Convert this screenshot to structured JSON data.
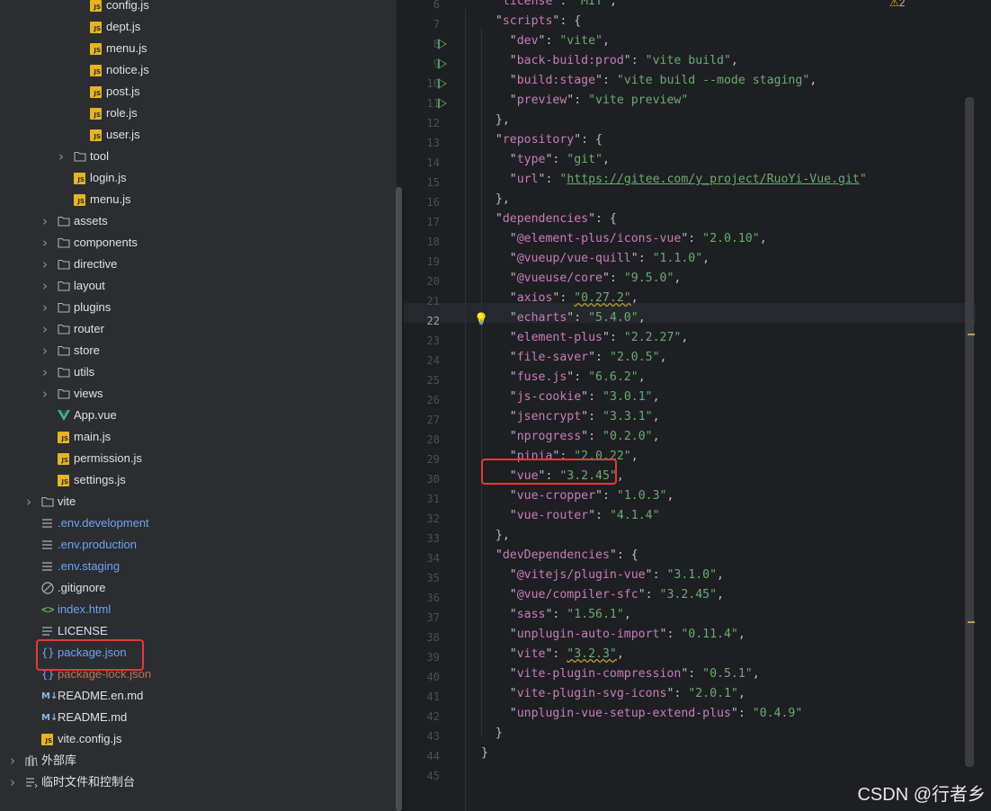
{
  "project_tree": {
    "items": [
      {
        "label": "config.js",
        "type": "js",
        "indent": 4
      },
      {
        "label": "dept.js",
        "type": "js",
        "indent": 4
      },
      {
        "label": "menu.js",
        "type": "js",
        "indent": 4
      },
      {
        "label": "notice.js",
        "type": "js",
        "indent": 4
      },
      {
        "label": "post.js",
        "type": "js",
        "indent": 4
      },
      {
        "label": "role.js",
        "type": "js",
        "indent": 4
      },
      {
        "label": "user.js",
        "type": "js",
        "indent": 4
      },
      {
        "label": "tool",
        "type": "folder",
        "indent": 3
      },
      {
        "label": "login.js",
        "type": "js",
        "indent": 3
      },
      {
        "label": "menu.js",
        "type": "js",
        "indent": 3
      },
      {
        "label": "assets",
        "type": "folder",
        "indent": 2
      },
      {
        "label": "components",
        "type": "folder",
        "indent": 2
      },
      {
        "label": "directive",
        "type": "folder",
        "indent": 2
      },
      {
        "label": "layout",
        "type": "folder",
        "indent": 2
      },
      {
        "label": "plugins",
        "type": "folder",
        "indent": 2
      },
      {
        "label": "router",
        "type": "folder",
        "indent": 2
      },
      {
        "label": "store",
        "type": "folder",
        "indent": 2
      },
      {
        "label": "utils",
        "type": "folder",
        "indent": 2
      },
      {
        "label": "views",
        "type": "folder",
        "indent": 2
      },
      {
        "label": "App.vue",
        "type": "vue",
        "indent": 2
      },
      {
        "label": "main.js",
        "type": "js",
        "indent": 2
      },
      {
        "label": "permission.js",
        "type": "js",
        "indent": 2
      },
      {
        "label": "settings.js",
        "type": "js",
        "indent": 2
      },
      {
        "label": "vite",
        "type": "folder",
        "indent": 1
      },
      {
        "label": ".env.development",
        "type": "env",
        "indent": 1
      },
      {
        "label": ".env.production",
        "type": "env",
        "indent": 1
      },
      {
        "label": ".env.staging",
        "type": "env",
        "indent": 1
      },
      {
        "label": ".gitignore",
        "type": "ignore",
        "indent": 1
      },
      {
        "label": "index.html",
        "type": "html",
        "indent": 1
      },
      {
        "label": "LICENSE",
        "type": "text",
        "indent": 1
      },
      {
        "label": "package.json",
        "type": "json",
        "indent": 1
      },
      {
        "label": "package-lock.json",
        "type": "json-orange",
        "indent": 1
      },
      {
        "label": "README.en.md",
        "type": "md",
        "indent": 1
      },
      {
        "label": "README.md",
        "type": "md",
        "indent": 1
      },
      {
        "label": "vite.config.js",
        "type": "js",
        "indent": 1
      },
      {
        "label": "外部库",
        "type": "lib",
        "indent": 0
      },
      {
        "label": "临时文件和控制台",
        "type": "scratch",
        "indent": 0
      }
    ]
  },
  "editor": {
    "warning_count": "2",
    "lines": [
      {
        "n": "6",
        "tokens": [
          [
            "p",
            "  \""
          ],
          [
            "k",
            "license"
          ],
          [
            "p",
            "\": "
          ],
          [
            "s",
            "\"MIT\""
          ],
          [
            "p",
            ","
          ]
        ]
      },
      {
        "n": "7",
        "tokens": [
          [
            "p",
            "  \""
          ],
          [
            "k",
            "scripts"
          ],
          [
            "p",
            "\": {"
          ]
        ]
      },
      {
        "n": "8",
        "tokens": [
          [
            "p",
            "    \""
          ],
          [
            "k",
            "dev"
          ],
          [
            "p",
            "\": "
          ],
          [
            "s",
            "\"vite\""
          ],
          [
            "p",
            ","
          ]
        ]
      },
      {
        "n": "9",
        "tokens": [
          [
            "p",
            "    \""
          ],
          [
            "k",
            "back-build:prod"
          ],
          [
            "p",
            "\": "
          ],
          [
            "s",
            "\"vite build\""
          ],
          [
            "p",
            ","
          ]
        ]
      },
      {
        "n": "10",
        "tokens": [
          [
            "p",
            "    \""
          ],
          [
            "k",
            "build:stage"
          ],
          [
            "p",
            "\": "
          ],
          [
            "s",
            "\"vite build --mode staging\""
          ],
          [
            "p",
            ","
          ]
        ]
      },
      {
        "n": "11",
        "tokens": [
          [
            "p",
            "    \""
          ],
          [
            "k",
            "preview"
          ],
          [
            "p",
            "\": "
          ],
          [
            "s",
            "\"vite preview\""
          ]
        ]
      },
      {
        "n": "12",
        "tokens": [
          [
            "p",
            "  },"
          ]
        ]
      },
      {
        "n": "13",
        "tokens": [
          [
            "p",
            "  \""
          ],
          [
            "k",
            "repository"
          ],
          [
            "p",
            "\": {"
          ]
        ]
      },
      {
        "n": "14",
        "tokens": [
          [
            "p",
            "    \""
          ],
          [
            "k",
            "type"
          ],
          [
            "p",
            "\": "
          ],
          [
            "s",
            "\"git\""
          ],
          [
            "p",
            ","
          ]
        ]
      },
      {
        "n": "15",
        "tokens": [
          [
            "p",
            "    \""
          ],
          [
            "k",
            "url"
          ],
          [
            "p",
            "\": "
          ],
          [
            "s",
            "\""
          ],
          [
            "u",
            "https://gitee.com/y_project/RuoYi-Vue.git"
          ],
          [
            "s",
            "\""
          ]
        ]
      },
      {
        "n": "16",
        "tokens": [
          [
            "p",
            "  },"
          ]
        ]
      },
      {
        "n": "17",
        "tokens": [
          [
            "p",
            "  \""
          ],
          [
            "k",
            "dependencies"
          ],
          [
            "p",
            "\": {"
          ]
        ]
      },
      {
        "n": "18",
        "tokens": [
          [
            "p",
            "    \""
          ],
          [
            "k",
            "@element-plus/icons-vue"
          ],
          [
            "p",
            "\": "
          ],
          [
            "s",
            "\"2.0.10\""
          ],
          [
            "p",
            ","
          ]
        ]
      },
      {
        "n": "19",
        "tokens": [
          [
            "p",
            "    \""
          ],
          [
            "k",
            "@vueup/vue-quill"
          ],
          [
            "p",
            "\": "
          ],
          [
            "s",
            "\"1.1.0\""
          ],
          [
            "p",
            ","
          ]
        ]
      },
      {
        "n": "20",
        "tokens": [
          [
            "p",
            "    \""
          ],
          [
            "k",
            "@vueuse/core"
          ],
          [
            "p",
            "\": "
          ],
          [
            "s",
            "\"9.5.0\""
          ],
          [
            "p",
            ","
          ]
        ]
      },
      {
        "n": "21",
        "tokens": [
          [
            "p",
            "    \""
          ],
          [
            "k",
            "axios"
          ],
          [
            "p",
            "\": "
          ],
          [
            "w",
            "\"0.27.2\""
          ],
          [
            "p",
            ","
          ]
        ]
      },
      {
        "n": "22",
        "tokens": [
          [
            "p",
            "    \""
          ],
          [
            "k",
            "echarts"
          ],
          [
            "p",
            "\": "
          ],
          [
            "s",
            "\"5.4.0\""
          ],
          [
            "p",
            ","
          ]
        ]
      },
      {
        "n": "23",
        "tokens": [
          [
            "p",
            "    \""
          ],
          [
            "k",
            "element-plus"
          ],
          [
            "p",
            "\": "
          ],
          [
            "s",
            "\"2.2.27\""
          ],
          [
            "p",
            ","
          ]
        ]
      },
      {
        "n": "24",
        "tokens": [
          [
            "p",
            "    \""
          ],
          [
            "k",
            "file-saver"
          ],
          [
            "p",
            "\": "
          ],
          [
            "s",
            "\"2.0.5\""
          ],
          [
            "p",
            ","
          ]
        ]
      },
      {
        "n": "25",
        "tokens": [
          [
            "p",
            "    \""
          ],
          [
            "k",
            "fuse.js"
          ],
          [
            "p",
            "\": "
          ],
          [
            "s",
            "\"6.6.2\""
          ],
          [
            "p",
            ","
          ]
        ]
      },
      {
        "n": "26",
        "tokens": [
          [
            "p",
            "    \""
          ],
          [
            "k",
            "js-cookie"
          ],
          [
            "p",
            "\": "
          ],
          [
            "s",
            "\"3.0.1\""
          ],
          [
            "p",
            ","
          ]
        ]
      },
      {
        "n": "27",
        "tokens": [
          [
            "p",
            "    \""
          ],
          [
            "k",
            "jsencrypt"
          ],
          [
            "p",
            "\": "
          ],
          [
            "s",
            "\"3.3.1\""
          ],
          [
            "p",
            ","
          ]
        ]
      },
      {
        "n": "28",
        "tokens": [
          [
            "p",
            "    \""
          ],
          [
            "k",
            "nprogress"
          ],
          [
            "p",
            "\": "
          ],
          [
            "s",
            "\"0.2.0\""
          ],
          [
            "p",
            ","
          ]
        ]
      },
      {
        "n": "29",
        "tokens": [
          [
            "p",
            "    \""
          ],
          [
            "k",
            "pinia"
          ],
          [
            "p",
            "\": "
          ],
          [
            "s",
            "\"2.0.22\""
          ],
          [
            "p",
            ","
          ]
        ]
      },
      {
        "n": "30",
        "tokens": [
          [
            "p",
            "    \""
          ],
          [
            "k",
            "vue"
          ],
          [
            "p",
            "\": "
          ],
          [
            "s",
            "\"3.2.45\""
          ],
          [
            "p",
            ","
          ]
        ]
      },
      {
        "n": "31",
        "tokens": [
          [
            "p",
            "    \""
          ],
          [
            "k",
            "vue-cropper"
          ],
          [
            "p",
            "\": "
          ],
          [
            "s",
            "\"1.0.3\""
          ],
          [
            "p",
            ","
          ]
        ]
      },
      {
        "n": "32",
        "tokens": [
          [
            "p",
            "    \""
          ],
          [
            "k",
            "vue-router"
          ],
          [
            "p",
            "\": "
          ],
          [
            "s",
            "\"4.1.4\""
          ]
        ]
      },
      {
        "n": "33",
        "tokens": [
          [
            "p",
            "  },"
          ]
        ]
      },
      {
        "n": "34",
        "tokens": [
          [
            "p",
            "  \""
          ],
          [
            "k",
            "devDependencies"
          ],
          [
            "p",
            "\": {"
          ]
        ]
      },
      {
        "n": "35",
        "tokens": [
          [
            "p",
            "    \""
          ],
          [
            "k",
            "@vitejs/plugin-vue"
          ],
          [
            "p",
            "\": "
          ],
          [
            "s",
            "\"3.1.0\""
          ],
          [
            "p",
            ","
          ]
        ]
      },
      {
        "n": "36",
        "tokens": [
          [
            "p",
            "    \""
          ],
          [
            "k",
            "@vue/compiler-sfc"
          ],
          [
            "p",
            "\": "
          ],
          [
            "s",
            "\"3.2.45\""
          ],
          [
            "p",
            ","
          ]
        ]
      },
      {
        "n": "37",
        "tokens": [
          [
            "p",
            "    \""
          ],
          [
            "k",
            "sass"
          ],
          [
            "p",
            "\": "
          ],
          [
            "s",
            "\"1.56.1\""
          ],
          [
            "p",
            ","
          ]
        ]
      },
      {
        "n": "38",
        "tokens": [
          [
            "p",
            "    \""
          ],
          [
            "k",
            "unplugin-auto-import"
          ],
          [
            "p",
            "\": "
          ],
          [
            "s",
            "\"0.11.4\""
          ],
          [
            "p",
            ","
          ]
        ]
      },
      {
        "n": "39",
        "tokens": [
          [
            "p",
            "    \""
          ],
          [
            "k",
            "vite"
          ],
          [
            "p",
            "\": "
          ],
          [
            "w",
            "\"3.2.3\""
          ],
          [
            "p",
            ","
          ]
        ]
      },
      {
        "n": "40",
        "tokens": [
          [
            "p",
            "    \""
          ],
          [
            "k",
            "vite-plugin-compression"
          ],
          [
            "p",
            "\": "
          ],
          [
            "s",
            "\"0.5.1\""
          ],
          [
            "p",
            ","
          ]
        ]
      },
      {
        "n": "41",
        "tokens": [
          [
            "p",
            "    \""
          ],
          [
            "k",
            "vite-plugin-svg-icons"
          ],
          [
            "p",
            "\": "
          ],
          [
            "s",
            "\"2.0.1\""
          ],
          [
            "p",
            ","
          ]
        ]
      },
      {
        "n": "42",
        "tokens": [
          [
            "p",
            "    \""
          ],
          [
            "k",
            "unplugin-vue-setup-extend-plus"
          ],
          [
            "p",
            "\": "
          ],
          [
            "s",
            "\"0.4.9\""
          ]
        ]
      },
      {
        "n": "43",
        "tokens": [
          [
            "p",
            "  }"
          ]
        ]
      },
      {
        "n": "44",
        "tokens": [
          [
            "p",
            "}"
          ]
        ]
      },
      {
        "n": "45",
        "tokens": []
      }
    ]
  },
  "watermark": "CSDN @行者乡",
  "colors": {
    "accent_red": "#e03a3a",
    "key_purple": "#c77dbb",
    "string_green": "#6aab73",
    "js_yellow": "#e6b422"
  }
}
